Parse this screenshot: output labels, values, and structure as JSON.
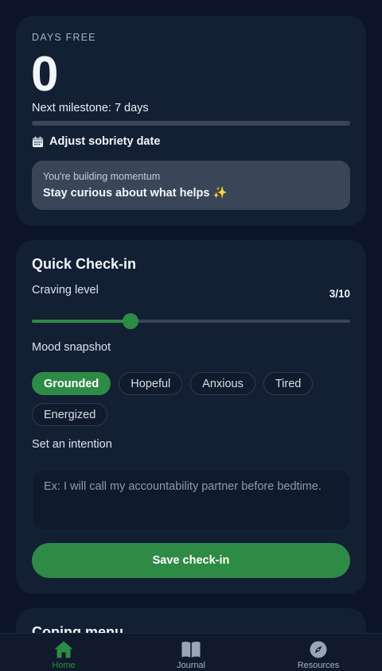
{
  "days": {
    "eyebrow": "DAYS FREE",
    "count": "0",
    "milestone": "Next milestone: 7 days",
    "milestone_progress": 0.0,
    "adjust_label": "Adjust sobriety date",
    "momentum_sub": "You're building momentum",
    "momentum_title": "Stay curious about what helps ✨"
  },
  "checkin": {
    "title": "Quick Check-in",
    "craving_label": "Craving level",
    "craving_value": "3/10",
    "craving_level": 3,
    "craving_max": 10,
    "mood_label": "Mood snapshot",
    "moods": [
      {
        "label": "Grounded",
        "selected": true
      },
      {
        "label": "Hopeful",
        "selected": false
      },
      {
        "label": "Anxious",
        "selected": false
      },
      {
        "label": "Tired",
        "selected": false
      },
      {
        "label": "Energized",
        "selected": false
      }
    ],
    "intention_label": "Set an intention",
    "intention_placeholder": "Ex: I will call my accountability partner before bedtime.",
    "intention_value": "",
    "save_label": "Save check-in"
  },
  "coping": {
    "title": "Coping menu"
  },
  "tabs": [
    {
      "label": "Home",
      "icon": "home-icon",
      "active": true
    },
    {
      "label": "Journal",
      "icon": "book-icon",
      "active": false
    },
    {
      "label": "Resources",
      "icon": "compass-icon",
      "active": false
    }
  ],
  "colors": {
    "accent": "#2e8b45",
    "background": "#0b1428",
    "card": "#131f33"
  }
}
